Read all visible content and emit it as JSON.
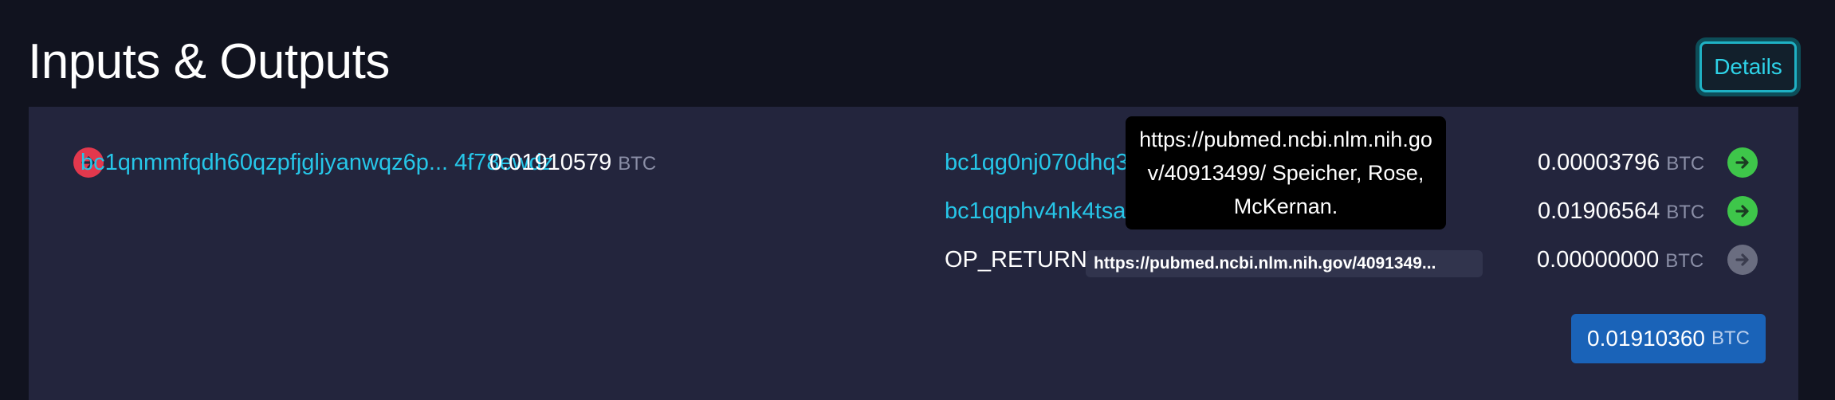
{
  "header": {
    "title": "Inputs & Outputs",
    "details_label": "Details"
  },
  "inputs": [
    {
      "address": "bc1qnmmfqdh60qzpfjgljyanwqz6p... 4f78ewdz",
      "amount": "0.01910579",
      "unit": "BTC",
      "icon": "arrow-right-circle-red-icon"
    }
  ],
  "outputs": [
    {
      "address": "bc1qg0nj070dhq3",
      "amount": "0.00003796",
      "unit": "BTC",
      "icon": "arrow-right-circle-green-icon"
    },
    {
      "address": "bc1qqphv4nk4tsa",
      "amount": "0.01906564",
      "unit": "BTC",
      "icon": "arrow-right-circle-green-icon"
    },
    {
      "label": "OP_RETURN",
      "data": "https://pubmed.ncbi.nlm.nih.gov/4091349...",
      "amount": "0.00000000",
      "unit": "BTC",
      "icon": "arrow-right-circle-gray-icon"
    }
  ],
  "total": {
    "amount": "0.01910360",
    "unit": "BTC"
  },
  "tooltip": {
    "text": "https://pubmed.ncbi.nlm.nih.gov/40913499/ Speicher, Rose, McKernan."
  },
  "colors": {
    "background": "#11131f",
    "panel": "#23253d",
    "address": "#26c6e8",
    "input_arrow": "#e2384d",
    "output_arrow": "#3ec64a",
    "op_return_arrow": "#6a6d80",
    "total_badge": "#1a63b8",
    "details_border": "#1fb1c4"
  }
}
